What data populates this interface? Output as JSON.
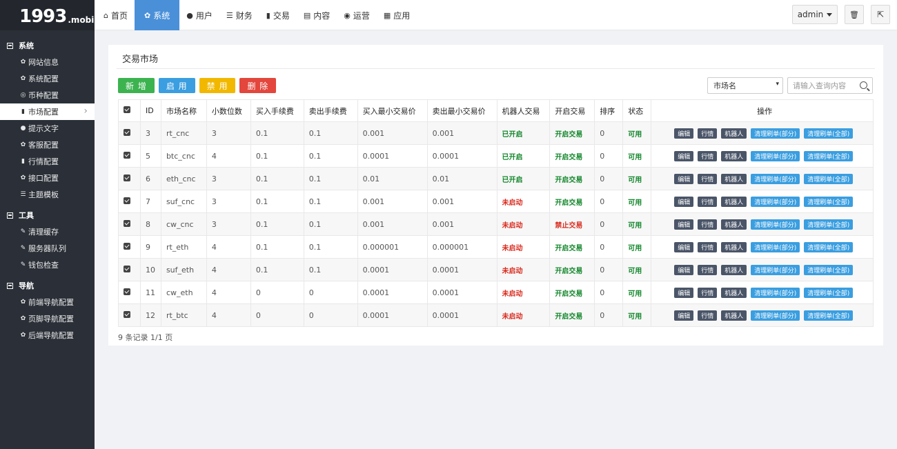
{
  "logo": {
    "big": "1993",
    "small": ".mobi"
  },
  "top_tabs": [
    {
      "label": "首页",
      "icon": "home-icon",
      "glyph": "⌂",
      "active": false
    },
    {
      "label": "系统",
      "icon": "gear-icon",
      "glyph": "✿",
      "active": true
    },
    {
      "label": "用户",
      "icon": "user-icon",
      "glyph": "●",
      "active": false
    },
    {
      "label": "财务",
      "icon": "list-icon",
      "glyph": "☰",
      "active": false
    },
    {
      "label": "交易",
      "icon": "bar-chart-icon",
      "glyph": "▮",
      "active": false
    },
    {
      "label": "内容",
      "icon": "document-icon",
      "glyph": "▤",
      "active": false
    },
    {
      "label": "运营",
      "icon": "globe-icon",
      "glyph": "◉",
      "active": false
    },
    {
      "label": "应用",
      "icon": "grid-icon",
      "glyph": "▦",
      "active": false
    }
  ],
  "top_right": {
    "user": "admin",
    "trash_glyph": "🗑",
    "logout_glyph": "⇱"
  },
  "sidebar": {
    "sections": [
      {
        "title": "系统",
        "items": [
          {
            "label": "网站信息",
            "icon": "gear-icon",
            "glyph": "✿"
          },
          {
            "label": "系统配置",
            "icon": "gear-icon",
            "glyph": "✿"
          },
          {
            "label": "币种配置",
            "icon": "circle-icon",
            "glyph": "◎"
          },
          {
            "label": "市场配置",
            "icon": "bar-chart-icon",
            "glyph": "▮",
            "active": true
          },
          {
            "label": "提示文字",
            "icon": "info-icon",
            "glyph": "●"
          },
          {
            "label": "客服配置",
            "icon": "gear-icon",
            "glyph": "✿"
          },
          {
            "label": "行情配置",
            "icon": "bar-chart-icon",
            "glyph": "▮"
          },
          {
            "label": "接口配置",
            "icon": "gear-icon",
            "glyph": "✿"
          },
          {
            "label": "主题模板",
            "icon": "list-icon",
            "glyph": "☰"
          }
        ]
      },
      {
        "title": "工具",
        "items": [
          {
            "label": "清理缓存",
            "icon": "wrench-icon",
            "glyph": "✎"
          },
          {
            "label": "服务器队列",
            "icon": "wrench-icon",
            "glyph": "✎"
          },
          {
            "label": "钱包检查",
            "icon": "wrench-icon",
            "glyph": "✎"
          }
        ]
      },
      {
        "title": "导航",
        "items": [
          {
            "label": "前端导航配置",
            "icon": "gear-icon",
            "glyph": "✿"
          },
          {
            "label": "页脚导航配置",
            "icon": "gear-icon",
            "glyph": "✿"
          },
          {
            "label": "后端导航配置",
            "icon": "gear-icon",
            "glyph": "✿"
          }
        ]
      }
    ]
  },
  "panel": {
    "title": "交易市场",
    "buttons": {
      "add": "新 增",
      "enable": "启 用",
      "disable": "禁 用",
      "delete": "删 除"
    },
    "filter_value": "市场名",
    "search_placeholder": "请输入查询内容",
    "columns": [
      "ID",
      "市场名称",
      "小数位数",
      "买入手续费",
      "卖出手续费",
      "买入最小交易价",
      "卖出最小交易价",
      "机器人交易",
      "开启交易",
      "排序",
      "状态",
      "操作"
    ],
    "row_actions": [
      "编辑",
      "行情",
      "机器人",
      "清理刷单(部分)",
      "清理刷单(全部)"
    ],
    "rows": [
      {
        "id": "3",
        "name": "rt_cnc",
        "decimals": "3",
        "buy_fee": "0.1",
        "sell_fee": "0.1",
        "buy_min": "0.001",
        "sell_min": "0.001",
        "robot": "已开启",
        "robot_on": true,
        "trade": "开启交易",
        "trade_on": true,
        "sort": "0",
        "status": "可用"
      },
      {
        "id": "5",
        "name": "btc_cnc",
        "decimals": "4",
        "buy_fee": "0.1",
        "sell_fee": "0.1",
        "buy_min": "0.0001",
        "sell_min": "0.0001",
        "robot": "已开启",
        "robot_on": true,
        "trade": "开启交易",
        "trade_on": true,
        "sort": "0",
        "status": "可用"
      },
      {
        "id": "6",
        "name": "eth_cnc",
        "decimals": "3",
        "buy_fee": "0.1",
        "sell_fee": "0.1",
        "buy_min": "0.01",
        "sell_min": "0.01",
        "robot": "已开启",
        "robot_on": true,
        "trade": "开启交易",
        "trade_on": true,
        "sort": "0",
        "status": "可用"
      },
      {
        "id": "7",
        "name": "suf_cnc",
        "decimals": "3",
        "buy_fee": "0.1",
        "sell_fee": "0.1",
        "buy_min": "0.001",
        "sell_min": "0.001",
        "robot": "未启动",
        "robot_on": false,
        "trade": "开启交易",
        "trade_on": true,
        "sort": "0",
        "status": "可用"
      },
      {
        "id": "8",
        "name": "cw_cnc",
        "decimals": "3",
        "buy_fee": "0.1",
        "sell_fee": "0.1",
        "buy_min": "0.001",
        "sell_min": "0.001",
        "robot": "未启动",
        "robot_on": false,
        "trade": "禁止交易",
        "trade_on": false,
        "sort": "0",
        "status": "可用"
      },
      {
        "id": "9",
        "name": "rt_eth",
        "decimals": "4",
        "buy_fee": "0.1",
        "sell_fee": "0.1",
        "buy_min": "0.000001",
        "sell_min": "0.000001",
        "robot": "未启动",
        "robot_on": false,
        "trade": "开启交易",
        "trade_on": true,
        "sort": "0",
        "status": "可用"
      },
      {
        "id": "10",
        "name": "suf_eth",
        "decimals": "4",
        "buy_fee": "0.1",
        "sell_fee": "0.1",
        "buy_min": "0.0001",
        "sell_min": "0.0001",
        "robot": "未启动",
        "robot_on": false,
        "trade": "开启交易",
        "trade_on": true,
        "sort": "0",
        "status": "可用"
      },
      {
        "id": "11",
        "name": "cw_eth",
        "decimals": "4",
        "buy_fee": "0",
        "sell_fee": "0",
        "buy_min": "0.0001",
        "sell_min": "0.0001",
        "robot": "未启动",
        "robot_on": false,
        "trade": "开启交易",
        "trade_on": true,
        "sort": "0",
        "status": "可用"
      },
      {
        "id": "12",
        "name": "rt_btc",
        "decimals": "4",
        "buy_fee": "0",
        "sell_fee": "0",
        "buy_min": "0.0001",
        "sell_min": "0.0001",
        "robot": "未启动",
        "robot_on": false,
        "trade": "开启交易",
        "trade_on": true,
        "sort": "0",
        "status": "可用"
      }
    ],
    "page_info": "9 条记录 1/1 页"
  },
  "colors": {
    "active_tab": "#4a90d9",
    "sidebar_bg": "#2b3038",
    "green": "#11862a",
    "red": "#d92d20"
  }
}
